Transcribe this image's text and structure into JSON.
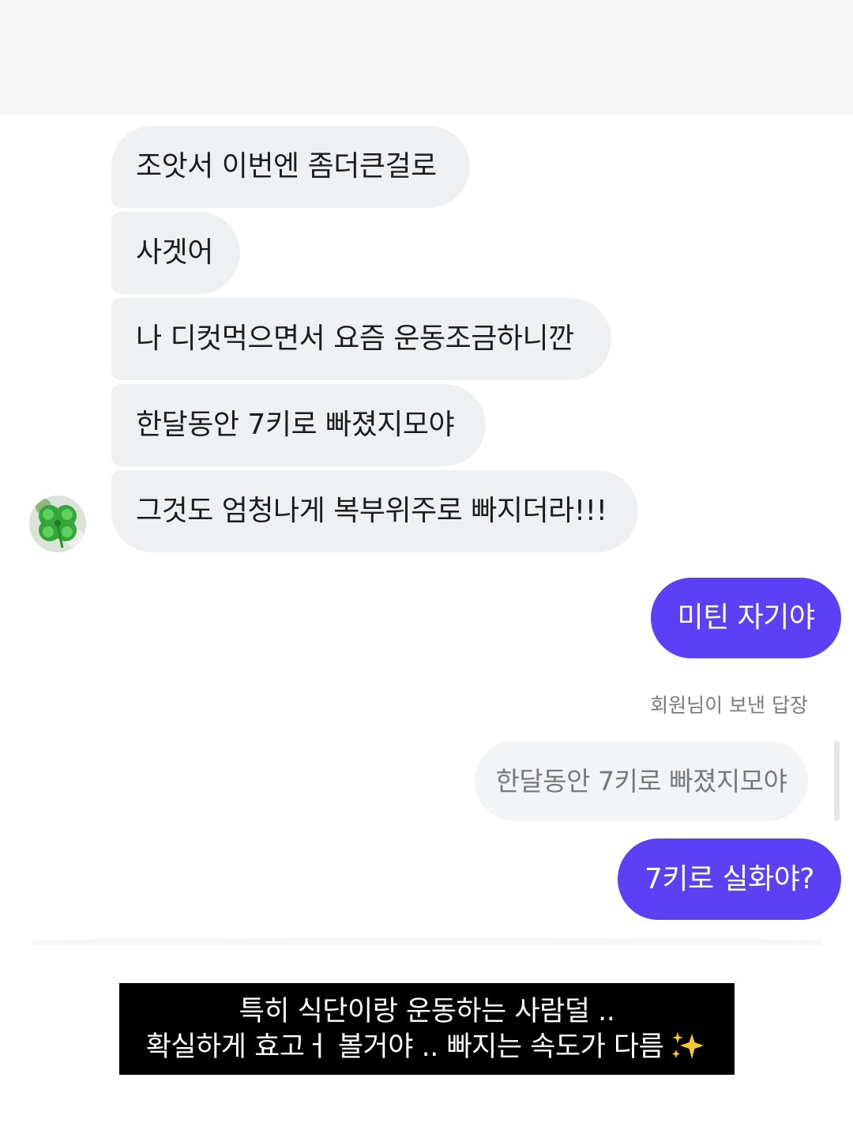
{
  "messages": {
    "incoming": [
      "조앗서 이번엔 좀더큰걸로",
      "사겟어",
      "나 디컷먹으면서 요즘 운동조금하니깐",
      "한달동안 7키로 빠졌지모야",
      "그것도 엄청나게 복부위주로 빠지더라!!!"
    ],
    "outgoing_1": "미틴 자기야",
    "reply_label": "회원님이 보낸 답장",
    "reply_quote": "한달동안 7키로 빠졌지모야",
    "outgoing_2": "7키로 실화야?"
  },
  "avatar": {
    "icon": "four-leaf-clover-icon"
  },
  "caption": {
    "line1": "특히 식단이랑 운동하는 사람덜 ..",
    "line2": "확실하게 효고ㅓ 볼거야 .. 빠지는 속도가 다름",
    "icon": "sparkles-icon"
  },
  "colors": {
    "incoming_bubble": "#eef0f2",
    "outgoing_bubble": "#5b40f6",
    "caption_bg": "#000000"
  }
}
